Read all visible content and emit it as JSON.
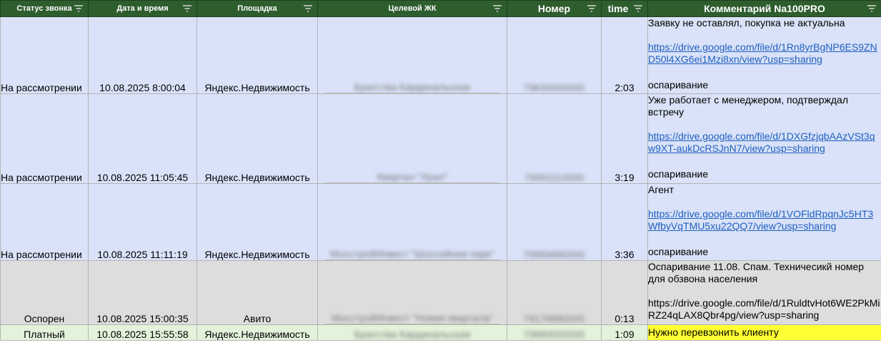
{
  "headers": [
    {
      "label": "Статус звонка",
      "filter_icon": "filter-icon"
    },
    {
      "label": "Дата и время",
      "filter_icon": "filter-icon"
    },
    {
      "label": "Площадка",
      "filter_icon": "filter-icon"
    },
    {
      "label": "Целевой ЖК",
      "filter_icon": "filter-icon"
    },
    {
      "label": "Номер",
      "filter_icon": "filter-icon"
    },
    {
      "label": "time",
      "filter_icon": "filter-icon"
    },
    {
      "label": "Комментарий Na100PRO",
      "filter_icon": "filter-icon"
    }
  ],
  "rows": [
    {
      "status": "На рассмотрении",
      "datetime": "10.08.2025 8:00:04",
      "platform": "Яндекс.Недвижимость",
      "complex": "Братства Кардинальская",
      "number": "79630000000",
      "time": "2:03",
      "comment_text": "Заявку не оставлял, покупка не актуальна",
      "comment_link": "https://drive.google.com/file/d/1Rn8yrBgNP6ES9ZND50l4XG6ei1Mzi8xn/view?usp=sharing",
      "comment_note": "оспаривание"
    },
    {
      "status": "На рассмотрении",
      "datetime": "10.08.2025 11:05:45",
      "platform": "Яндекс.Недвижимость",
      "complex": "Квартал \"Урал\"",
      "number": "79991110000",
      "time": "3:19",
      "comment_text": "Уже работает с менеджером, подтверждал встречу",
      "comment_link": "https://drive.google.com/file/d/1DXGfzjqbAAzVSt3qw9XT-aukDcRSJnN7/view?usp=sharing",
      "comment_note": "оспаривание"
    },
    {
      "status": "На рассмотрении",
      "datetime": "10.08.2025 11:11:19",
      "platform": "Яндекс.Недвижимость",
      "complex": "МосстройИнвест \"Шоссейная парк\"",
      "number": "79889880000",
      "time": "3:36",
      "comment_text": "Агент",
      "comment_link": "https://drive.google.com/file/d/1VOFldRpqnJc5HT3WfbyVqTMU5xu22QQ7/view?usp=sharing",
      "comment_note": "оспаривание"
    },
    {
      "status": "Оспорен",
      "datetime": "10.08.2025 15:00:35",
      "platform": "Авито",
      "complex": "МосстройИнвест \"Новая квартала\"",
      "number": "79178880000",
      "time": "0:13",
      "comment_text": "Оспаривание 11.08. Спам. Техничесикй номер для обзвона населения",
      "comment_link": "https://drive.google.com/file/d/1RuldtvHot6WE2PkMiRZ24qLAX8Qbr4pg/view?usp=sharing",
      "comment_note": ""
    },
    {
      "status": "Платный",
      "datetime": "10.08.2025 15:55:58",
      "platform": "Яндекс.Недвижимость",
      "complex": "Братства Кардинальская",
      "number": "79880000000",
      "time": "1:09",
      "comment_text": "Нужно перевзонить клиенту",
      "comment_link": "",
      "comment_note": ""
    }
  ],
  "colors": {
    "header_bg": "#2e5d2e",
    "row_pending": "#d9e2f8",
    "row_disputed": "#dddddd",
    "row_paid": "#e3f2db",
    "highlight": "#ffff33",
    "link": "#1f5fbf"
  }
}
